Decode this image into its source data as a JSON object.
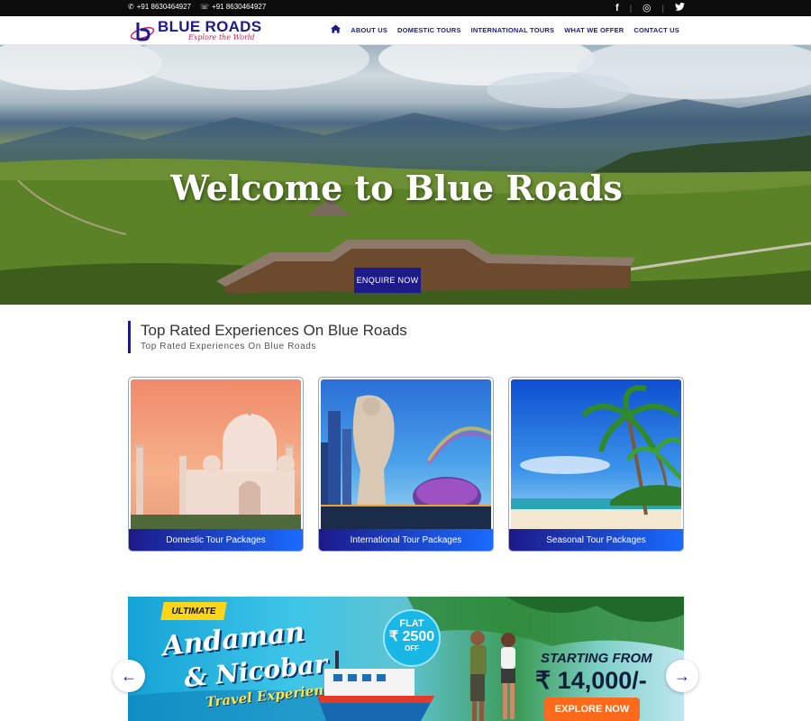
{
  "topbar": {
    "phone": "+91 8630464927",
    "whatsapp": "+91 8630464927",
    "social": [
      "facebook-icon",
      "instagram-icon",
      "twitter-icon"
    ],
    "social_glyphs": {
      "facebook": "f",
      "instagram": "◎",
      "twitter": "🐦"
    }
  },
  "brand": {
    "name": "BLUE ROADS",
    "tagline": "Explore the World",
    "primary_color": "#1d1a8a",
    "accent_color": "#d21f5b"
  },
  "nav": {
    "items": [
      "ABOUT US",
      "DOMESTIC TOURS",
      "INTERNATIONAL TOURS",
      "WHAT WE OFFER",
      "CONTACT US"
    ]
  },
  "hero": {
    "title": "Welcome to Blue Roads",
    "button": "ENQUIRE NOW",
    "slides": 8,
    "active_slide": 1
  },
  "section": {
    "title": "Top Rated Experiences On Blue Roads",
    "subtitle": "Top Rated Experiences On Blue Roads"
  },
  "cards": [
    {
      "label": "Domestic Tour Packages",
      "image": "taj-mahal"
    },
    {
      "label": "International Tour Packages",
      "image": "singapore-merlion"
    },
    {
      "label": "Seasonal Tour Packages",
      "image": "tropical-beach"
    }
  ],
  "banner": {
    "badge": "ULTIMATE",
    "line1": "Andaman",
    "line2": "& Nicobar",
    "line3": "Travel Experiences",
    "flat_label": "FLAT",
    "flat_amount": "₹ 2500",
    "flat_off": "OFF",
    "starting": "STARTING FROM",
    "price": "₹ 14,000/-",
    "cta": "EXPLORE NOW"
  },
  "carousel": {
    "prev": "←",
    "next": "→"
  }
}
